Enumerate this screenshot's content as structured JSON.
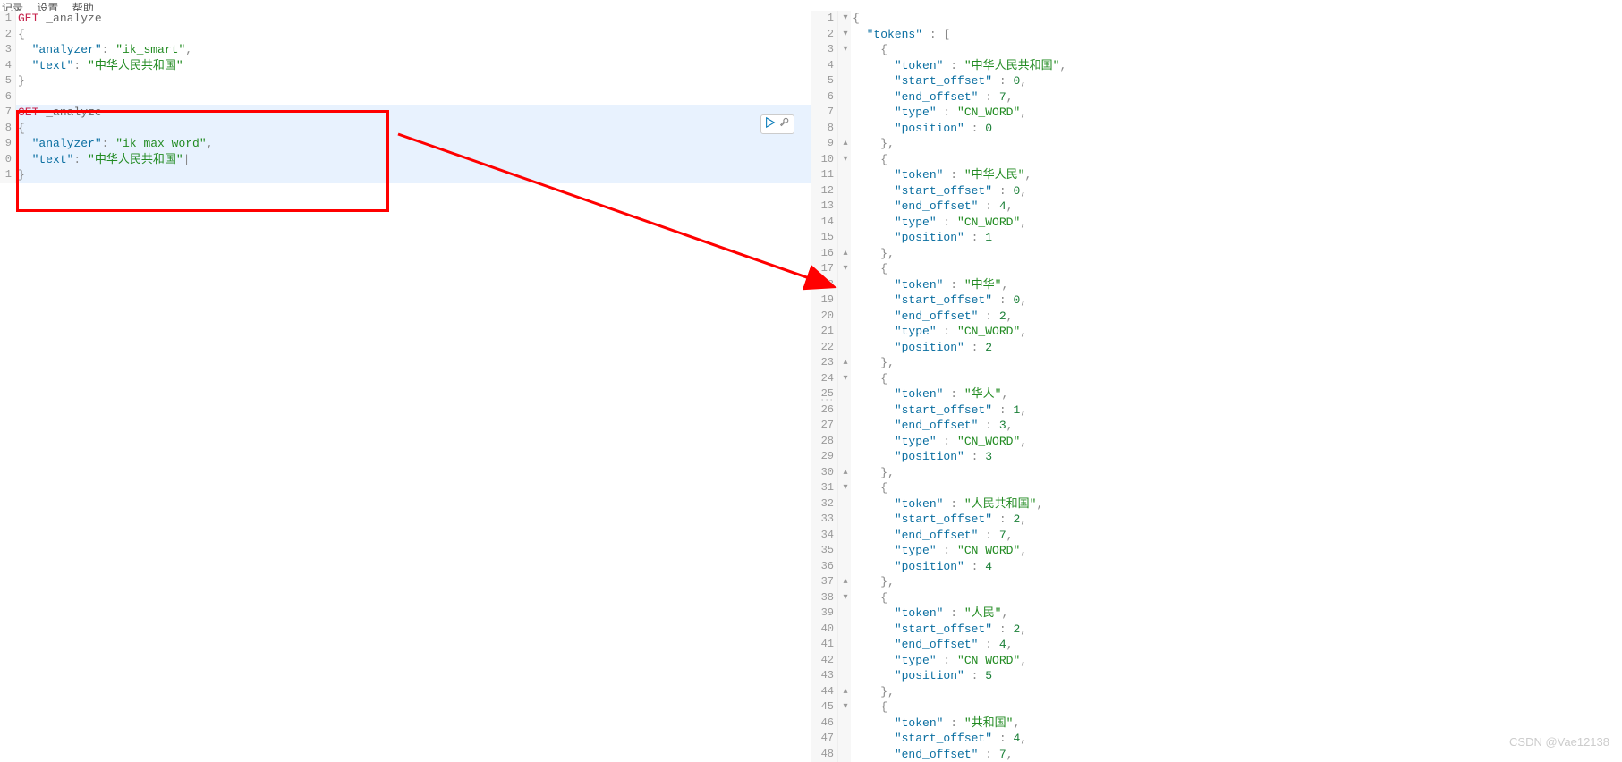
{
  "top_menu": {
    "item1": "记录",
    "item2": "设置",
    "item3": "帮助"
  },
  "left_editor": {
    "request1": {
      "method": "GET",
      "endpoint": "_analyze",
      "analyzer_key": "\"analyzer\"",
      "analyzer_val": "\"ik_smart\"",
      "text_key": "\"text\"",
      "text_val": "\"中华人民共和国\""
    },
    "request2": {
      "method": "GET",
      "endpoint": "_analyze",
      "analyzer_key": "\"analyzer\"",
      "analyzer_val": "\"ik_max_word\"",
      "text_key": "\"text\"",
      "text_val": "\"中华人民共和国\""
    },
    "line_numbers": [
      "1",
      "2",
      "3",
      "4",
      "5",
      "6",
      "7",
      "8",
      "9",
      "0",
      "1"
    ],
    "fold_marks": [
      "",
      "▾",
      "",
      "",
      "▴",
      "",
      "",
      "▾",
      "",
      "",
      "▴"
    ]
  },
  "right_editor": {
    "line_numbers": [
      "1",
      "2",
      "3",
      "4",
      "5",
      "6",
      "7",
      "8",
      "9",
      "10",
      "11",
      "12",
      "13",
      "14",
      "15",
      "16",
      "17",
      "18",
      "19",
      "20",
      "21",
      "22",
      "23",
      "24",
      "25",
      "26",
      "27",
      "28",
      "29",
      "30",
      "31",
      "32",
      "33",
      "34",
      "35",
      "36",
      "37",
      "38",
      "39",
      "40",
      "41",
      "42",
      "43",
      "44",
      "45",
      "46",
      "47",
      "48"
    ],
    "fold_marks": [
      "▾",
      "▾",
      "▾",
      "",
      "",
      "",
      "",
      "",
      "▴",
      "▾",
      "",
      "",
      "",
      "",
      "",
      "▴",
      "▾",
      "",
      "",
      "",
      "",
      "",
      "▴",
      "▾",
      "",
      "",
      "",
      "",
      "",
      "▴",
      "▾",
      "",
      "",
      "",
      "",
      "",
      "▴",
      "▾",
      "",
      "",
      "",
      "",
      "",
      "▴",
      "▾",
      "",
      "",
      ""
    ],
    "tokens_key": "\"tokens\"",
    "tokens": [
      {
        "token": "\"中华人民共和国\"",
        "start_offset": "0",
        "end_offset": "7",
        "type": "\"CN_WORD\"",
        "position": "0"
      },
      {
        "token": "\"中华人民\"",
        "start_offset": "0",
        "end_offset": "4",
        "type": "\"CN_WORD\"",
        "position": "1"
      },
      {
        "token": "\"中华\"",
        "start_offset": "0",
        "end_offset": "2",
        "type": "\"CN_WORD\"",
        "position": "2"
      },
      {
        "token": "\"华人\"",
        "start_offset": "1",
        "end_offset": "3",
        "type": "\"CN_WORD\"",
        "position": "3"
      },
      {
        "token": "\"人民共和国\"",
        "start_offset": "2",
        "end_offset": "7",
        "type": "\"CN_WORD\"",
        "position": "4"
      },
      {
        "token": "\"人民\"",
        "start_offset": "2",
        "end_offset": "4",
        "type": "\"CN_WORD\"",
        "position": "5"
      },
      {
        "token": "\"共和国\"",
        "start_offset": "4",
        "end_offset": "7"
      }
    ],
    "keys": {
      "token": "\"token\"",
      "start_offset": "\"start_offset\"",
      "end_offset": "\"end_offset\"",
      "type": "\"type\"",
      "position": "\"position\""
    }
  },
  "watermark": "CSDN @Vae12138"
}
